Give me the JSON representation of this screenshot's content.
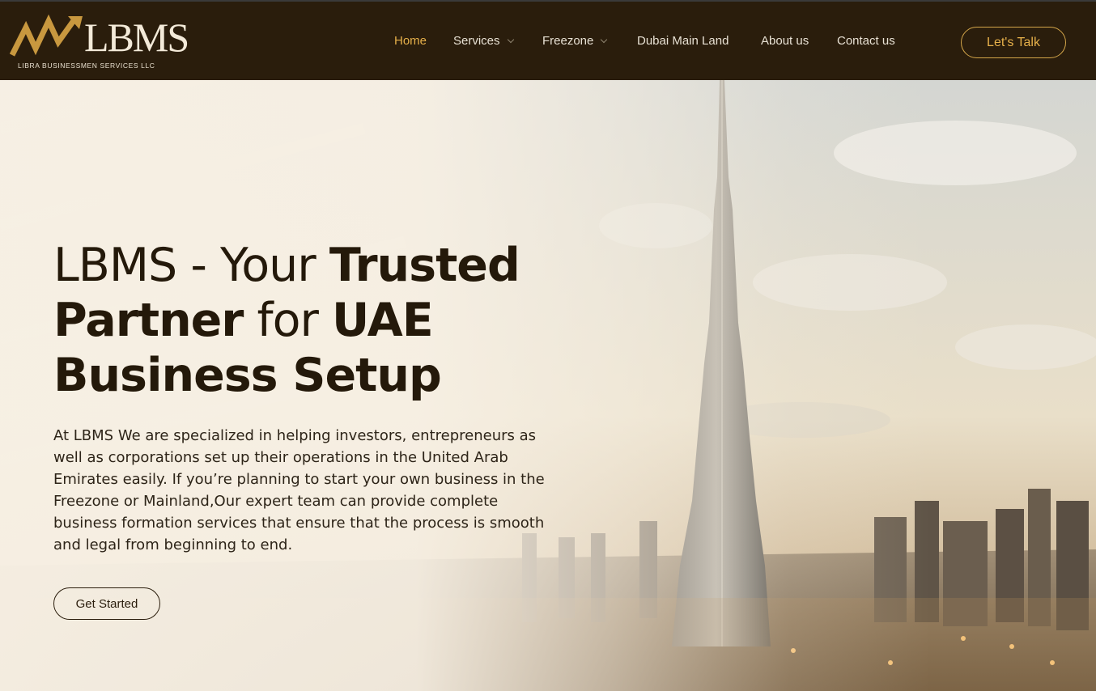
{
  "brand": {
    "name": "LBMS",
    "tagline": "LIBRA BUSINESSMEN SERVICES LLC",
    "accent": "#e6b04a",
    "header_bg": "#2a1d0c"
  },
  "nav": {
    "items": [
      {
        "label": "Home",
        "active": true
      },
      {
        "label": "Services",
        "dropdown": true
      },
      {
        "label": "Freezone",
        "dropdown": true
      },
      {
        "label": "Dubai Main Land"
      },
      {
        "label": "About us"
      },
      {
        "label": "Contact us"
      }
    ],
    "cta_label": "Let's Talk"
  },
  "hero": {
    "title_parts": {
      "p1": "LBMS - Your ",
      "p2": "Trusted",
      "p3": "Partner",
      "p4": " for ",
      "p5": "UAE",
      "p6": "Business Setup"
    },
    "description": "At LBMS We are specialized in helping investors, entrepreneurs as well as corporations set up their operations in the United Arab Emirates easily. If you’re planning to start your own business in the Freezone or Mainland,Our expert team can provide complete business formation services that ensure that the process is smooth and legal from beginning to end.",
    "cta_label": "Get Started",
    "background": "burj-khalifa-skyline-image"
  }
}
